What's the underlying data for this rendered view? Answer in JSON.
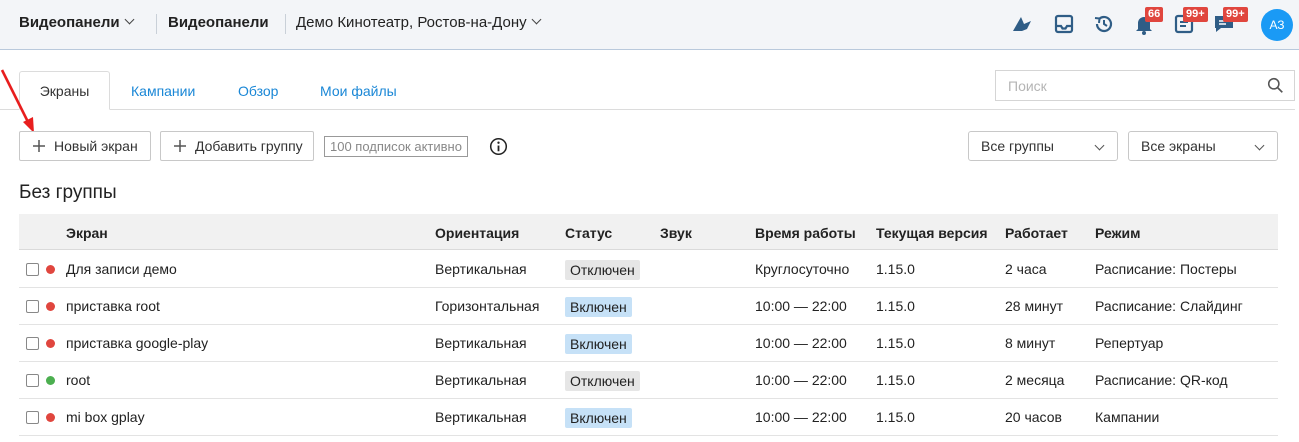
{
  "topbar": {
    "app_menu": "Видеопанели",
    "section": "Видеопанели",
    "location": "Демо Кинотеатр, Ростов-на-Дону",
    "icons": [
      "bird-icon",
      "inbox-icon",
      "history-icon",
      "bell-icon",
      "news-icon",
      "chat-icon"
    ],
    "badges": {
      "bell": "66",
      "news": "99+",
      "chat": "99+"
    },
    "avatar": "АЗ"
  },
  "tabs": [
    {
      "label": "Экраны",
      "active": true
    },
    {
      "label": "Кампании",
      "active": false
    },
    {
      "label": "Обзор",
      "active": false
    },
    {
      "label": "Мои файлы",
      "active": false
    }
  ],
  "search": {
    "placeholder": "Поиск",
    "value": ""
  },
  "toolbar": {
    "new_screen": "Новый экран",
    "add_group": "Добавить группу",
    "subscriptions": "100 подписок активно",
    "group_filter": "Все группы",
    "screen_filter": "Все экраны"
  },
  "group": {
    "title": "Без группы"
  },
  "table": {
    "headers": {
      "screen": "Экран",
      "orientation": "Ориентация",
      "status": "Статус",
      "sound": "Звук",
      "hours": "Время работы",
      "version": "Текущая версия",
      "uptime": "Работает",
      "mode": "Режим"
    },
    "rows": [
      {
        "name": "Для записи демо",
        "online": false,
        "orientation": "Вертикальная",
        "status": "Отключен",
        "status_on": false,
        "sound": "",
        "hours": "Круглосуточно",
        "version": "1.15.0",
        "uptime": "2 часа",
        "mode": "Расписание: Постеры"
      },
      {
        "name": "приставка root",
        "online": false,
        "orientation": "Горизонтальная",
        "status": "Включен",
        "status_on": true,
        "sound": "",
        "hours": "10:00 — 22:00",
        "version": "1.15.0",
        "uptime": "28 минут",
        "mode": "Расписание: Слайдинг"
      },
      {
        "name": "приставка google-play",
        "online": false,
        "orientation": "Вертикальная",
        "status": "Включен",
        "status_on": true,
        "sound": "",
        "hours": "10:00 — 22:00",
        "version": "1.15.0",
        "uptime": "8 минут",
        "mode": "Репертуар"
      },
      {
        "name": "root",
        "online": true,
        "orientation": "Вертикальная",
        "status": "Отключен",
        "status_on": false,
        "sound": "",
        "hours": "10:00 — 22:00",
        "version": "1.15.0",
        "uptime": "2 месяца",
        "mode": "Расписание: QR-код"
      },
      {
        "name": "mi box gplay",
        "online": false,
        "orientation": "Вертикальная",
        "status": "Включен",
        "status_on": true,
        "sound": "",
        "hours": "10:00 — 22:00",
        "version": "1.15.0",
        "uptime": "20 часов",
        "mode": "Кампании"
      }
    ]
  },
  "colors": {
    "accent": "#1a87d6",
    "badge": "#e0463e",
    "status_on_bg": "#c6e1f7",
    "status_off_bg": "#e6e6e6",
    "dot_offline": "#e0463e",
    "dot_online": "#4caf50",
    "annotation_arrow": "#e81e1e"
  }
}
